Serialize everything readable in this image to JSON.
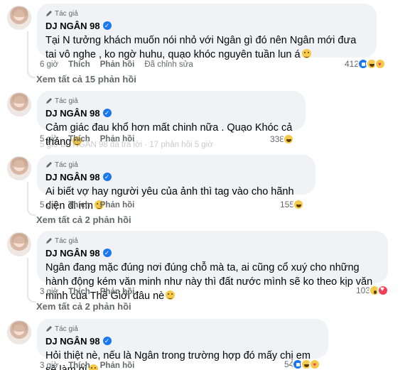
{
  "comments": [
    {
      "badge": "Tác giả",
      "name": "DJ NGÂN 98",
      "text": "Tại N tưởng khách muốn nói nhỏ với Ngân gì đó nên Ngân mới đưa tai vô nghe , ko ngờ huhu, quạo khóc nguyên tuần lun á",
      "time": "6 giờ",
      "like": "Thích",
      "reply": "Phản hồi",
      "edited": "Đã chỉnh sửa",
      "reaction_count": "412",
      "view_replies": "Xem tất cả 15 phản hồi"
    },
    {
      "badge": "Tác giả",
      "name": "DJ NGÂN 98",
      "text": "Cảm giác đau khổ hơn mất chinh nữa . Quạo Khóc cả tháng",
      "time": "5 giờ",
      "like": "Thích",
      "reply": "Phản hồi",
      "reaction_count": "338"
    },
    {
      "badge": "Tác giả",
      "name": "DJ NGÂN 98",
      "text": "Ai biết vợ hay người yêu của ảnh thì tag vào cho hãnh diện đi mn",
      "time": "5 giờ",
      "like": "Thích",
      "reply": "Phản hồi",
      "reaction_count": "155",
      "view_replies": "Xem tất cả 2 phản hồi"
    },
    {
      "badge": "Tác giả",
      "name": "DJ NGÂN 98",
      "text": "Ngân đang mặc đúng nơi đúng chỗ mà ta, ai cũng cổ xuý cho những hành động kém văn minh như này thì đất nước mình sẽ ko theo kịp văn minh của Thế Giới đâu nè",
      "time": "3 giờ",
      "like": "Thích",
      "reply": "Phản hồi",
      "reaction_count": "103",
      "view_replies": "Xem tất cả 2 phản hồi"
    },
    {
      "badge": "Tác giả",
      "name": "DJ NGÂN 98",
      "text": "Hỏi thiệt nè, nếu là Ngân trong trường hợp đó mấy chị em sẽ làm gì",
      "time": "3 giờ",
      "like": "Thích",
      "reply": "Phản hồi",
      "reaction_count": "54"
    }
  ],
  "faded_line": "5 giờ   DJ NGÂN 98 đã trả lời · 17 phản hồi  5 giờ",
  "colors": {
    "bubble": "#f0f2f5",
    "secondary_text": "#65676b",
    "verified": "#1877f2"
  },
  "icons": [
    "author-pen-icon",
    "verified-badge-icon",
    "like-reaction-icon",
    "haha-reaction-icon",
    "love-reaction-icon",
    "wow-reaction-icon",
    "care-reaction-icon",
    "emoji-icon"
  ]
}
